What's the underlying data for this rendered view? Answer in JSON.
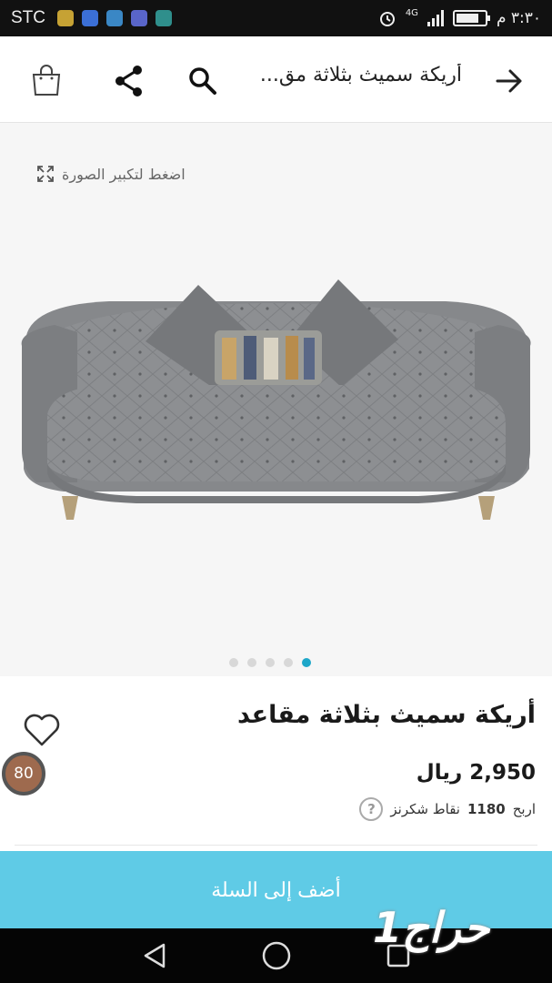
{
  "status_bar": {
    "carrier": "STC",
    "time": "٣:٣٠ م",
    "network": "4G",
    "battery_level": 0.8
  },
  "app_bar": {
    "title": "أريكة سميث بثلاثة مق...",
    "icons": [
      "back-arrow-icon",
      "search-icon",
      "share-icon",
      "shopping-bag-icon"
    ]
  },
  "gallery": {
    "zoom_hint": "اضغط لتكبير الصورة",
    "image_count": 5,
    "active_index": 4
  },
  "product": {
    "title": "أريكة سميث بثلاثة مقاعد",
    "price": "2,950 ريال",
    "points_prefix": "اربح",
    "points_value": "1180",
    "points_suffix": "نقاط شكرنز",
    "help_glyph": "?",
    "score": "80"
  },
  "actions": {
    "add_to_cart": "أضف إلى السلة"
  },
  "watermark": {
    "text": "حراج1"
  },
  "colors": {
    "accent": "#1ea7c9",
    "button": "#5fcbe6",
    "score_badge": "#9e6a4e"
  }
}
